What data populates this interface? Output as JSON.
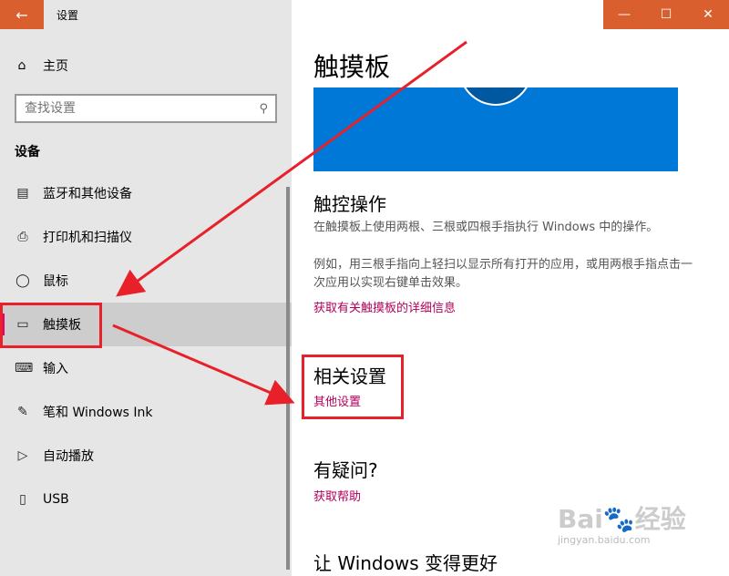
{
  "window": {
    "title": "设置",
    "back_icon": "←",
    "minimize": "—",
    "maximize": "☐",
    "close": "✕"
  },
  "sidebar": {
    "home_label": "主页",
    "search_placeholder": "查找设置",
    "section_label": "设备",
    "items": [
      {
        "label": "蓝牙和其他设备",
        "icon": "bluetooth-icon"
      },
      {
        "label": "打印机和扫描仪",
        "icon": "printer-icon"
      },
      {
        "label": "鼠标",
        "icon": "mouse-icon"
      },
      {
        "label": "触摸板",
        "icon": "touchpad-icon",
        "active": true
      },
      {
        "label": "输入",
        "icon": "keyboard-icon"
      },
      {
        "label": "笔和 Windows Ink",
        "icon": "pen-icon"
      },
      {
        "label": "自动播放",
        "icon": "autoplay-icon"
      },
      {
        "label": "USB",
        "icon": "usb-icon"
      }
    ]
  },
  "main": {
    "title": "触摸板",
    "touch_ops_heading": "触控操作",
    "touch_ops_desc": "在触摸板上使用两根、三根或四根手指执行 Windows 中的操作。",
    "example_desc": "例如，用三根手指向上轻扫以显示所有打开的应用，或用两根手指点击一次应用以实现右键单击效果。",
    "more_info_link": "获取有关触摸板的详细信息",
    "related_heading": "相关设置",
    "other_settings_link": "其他设置",
    "question_heading": "有疑问?",
    "help_link": "获取帮助",
    "improve_heading": "让 Windows 变得更好"
  },
  "watermark": {
    "brand": "Bai🐾经验",
    "url": "jingyan.baidu.com"
  },
  "colors": {
    "accent": "#d9602e",
    "link": "#b4005a",
    "active_marker": "#e0006e",
    "hero": "#0078d7",
    "annotation": "#e8202a"
  }
}
